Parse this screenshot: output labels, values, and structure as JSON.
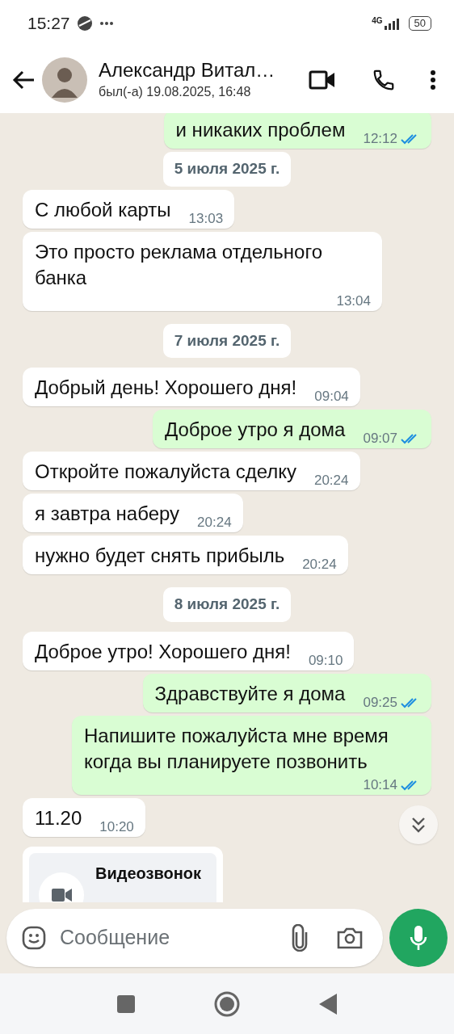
{
  "status_bar": {
    "time": "15:27",
    "network": "4G",
    "battery": "50"
  },
  "header": {
    "name": "Александр Витал…",
    "last_seen": "был(-а) 19.08.2025, 16:48"
  },
  "messages": [
    {
      "kind": "sent",
      "text": "и никаких проблем",
      "time": "12:12",
      "read": true
    },
    {
      "kind": "date",
      "text": "5 июля 2025 г."
    },
    {
      "kind": "received",
      "text": "С любой карты",
      "time": "13:03"
    },
    {
      "kind": "received",
      "text": "Это просто реклама отдельного банка",
      "time": "13:04"
    },
    {
      "kind": "date",
      "text": "7 июля 2025 г."
    },
    {
      "kind": "received",
      "text": "Добрый день! Хорошего дня!",
      "time": "09:04"
    },
    {
      "kind": "sent",
      "text": "Доброе утро я дома",
      "time": "09:07",
      "read": true
    },
    {
      "kind": "received",
      "text": "Откройте пожалуйста сделку",
      "time": "20:24"
    },
    {
      "kind": "received",
      "text": "я завтра наберу",
      "time": "20:24"
    },
    {
      "kind": "received",
      "text": "нужно будет снять прибыль",
      "time": "20:24"
    },
    {
      "kind": "date",
      "text": "8 июля 2025 г."
    },
    {
      "kind": "received",
      "text": "Доброе утро! Хорошего дня!",
      "time": "09:10"
    },
    {
      "kind": "sent",
      "text": "Здравствуйте я дома",
      "time": "09:25",
      "read": true
    },
    {
      "kind": "sent",
      "text": "Напишите пожалуйста мне время когда вы планируете позвонить",
      "time": "10:14",
      "read": true
    },
    {
      "kind": "received",
      "text": "11.20",
      "time": "10:20"
    },
    {
      "kind": "call",
      "text": "Видеозвонок"
    }
  ],
  "composer": {
    "placeholder": "Сообщение"
  }
}
